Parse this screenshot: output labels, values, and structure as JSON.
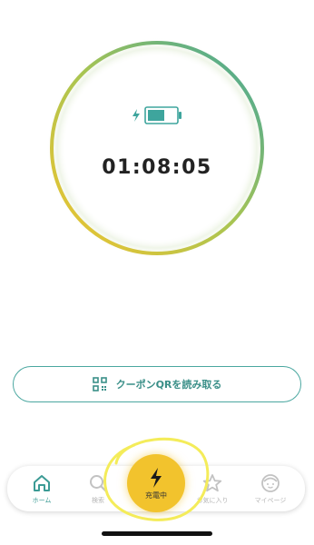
{
  "timer": {
    "elapsed": "01:08:05",
    "battery_level": 0.6,
    "ring_colors": [
      "#f2c32d",
      "#a9c552",
      "#3ea59d"
    ]
  },
  "coupon_button": {
    "label": "クーポンQRを読み取る",
    "icon": "qr-code-icon",
    "color": "#3a8f88"
  },
  "tabbar": {
    "items": [
      {
        "label": "ホーム",
        "icon": "home-icon",
        "active": true
      },
      {
        "label": "検索",
        "icon": "search-icon",
        "active": false
      },
      {
        "label": "充電中",
        "icon": "lightning-icon",
        "active": false
      },
      {
        "label": "お気に入り",
        "icon": "star-icon",
        "active": false
      },
      {
        "label": "マイページ",
        "icon": "user-face-icon",
        "active": false
      }
    ],
    "accent": "#3c9b95",
    "charge_color": "#f2c32d"
  }
}
